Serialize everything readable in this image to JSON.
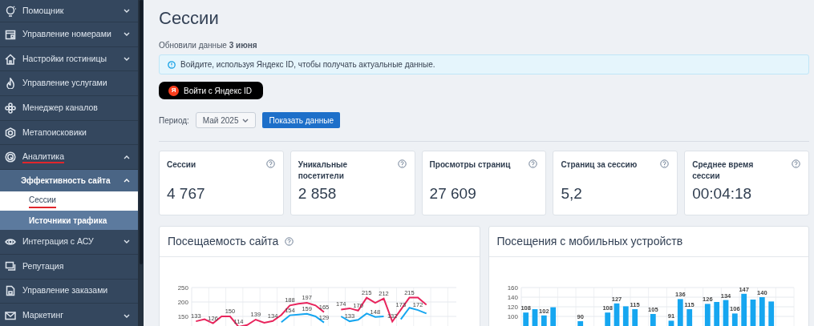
{
  "sidebar": {
    "items": [
      {
        "label": "Помощник",
        "expandable": true,
        "expanded": false,
        "underlined": false
      },
      {
        "label": "Управление номерами",
        "expandable": true,
        "expanded": false,
        "underlined": false
      },
      {
        "label": "Настройки гостиницы",
        "expandable": true,
        "expanded": false,
        "underlined": false
      },
      {
        "label": "Управление услугами",
        "expandable": false,
        "underlined": false
      },
      {
        "label": "Менеджер каналов",
        "expandable": false,
        "underlined": false
      },
      {
        "label": "Метапоисковики",
        "expandable": false,
        "underlined": false
      },
      {
        "label": "Аналитика",
        "expandable": true,
        "expanded": true,
        "underlined": true,
        "children": [
          {
            "label": "Эффективность сайта",
            "expandable": true,
            "expanded": true,
            "children": [
              {
                "label": "Сессии",
                "selected": true,
                "underlined": true
              },
              {
                "label": "Источники трафика",
                "selected": false,
                "underlined": false
              }
            ]
          }
        ]
      },
      {
        "label": "Интеграция с АСУ",
        "expandable": true,
        "expanded": false,
        "underlined": false
      },
      {
        "label": "Репутация",
        "expandable": false,
        "underlined": false
      },
      {
        "label": "Управление заказами",
        "expandable": false,
        "underlined": false
      },
      {
        "label": "Маркетинг",
        "expandable": true,
        "expanded": false,
        "underlined": false
      }
    ]
  },
  "page": {
    "title": "Сессии",
    "updated": "Обновили данные **3 июня**",
    "alert": "Войдите, используя Яндекс ID, чтобы получать актуальные данные.",
    "yandex_button": {
      "logo": "Я",
      "label": "Войти с Яндекс ID"
    },
    "period": {
      "label": "Период:",
      "value": "Май 2025"
    },
    "show_button": "Показать данные"
  },
  "metrics": [
    {
      "label": "Сессии",
      "value": "4 767"
    },
    {
      "label": "Уникальные посетители",
      "value": "2 858"
    },
    {
      "label": "Просмотры страниц",
      "value": "27 609"
    },
    {
      "label": "Страниц за сессию",
      "value": "5,2"
    },
    {
      "label": "Среднее время сессии",
      "value": "00:04:18"
    }
  ],
  "charts": [
    {
      "title": "Посещаемость сайта",
      "help": true,
      "chart_data": {
        "type": "line",
        "grid": true,
        "ylim": [
          0,
          250
        ],
        "yticks": [
          150,
          200,
          250
        ],
        "series": [
          {
            "color": "#e8245c",
            "values": [
              133,
              140,
              126,
              150,
              150,
              114,
              120,
              139,
              128,
              134,
              155,
              188,
              194,
              197,
              188,
              165,
              null,
              174,
              178,
              170,
              215,
              197,
              212,
              132,
              173,
              215,
              215,
              190,
              null,
              null,
              null
            ]
          },
          {
            "color": "#16a6f0",
            "values": [
              null,
              null,
              null,
              null,
              null,
              null,
              null,
              null,
              null,
              null,
              130,
              154,
              156,
              159,
              150,
              129,
              null,
              150,
              133,
              138,
              160,
              148,
              150,
              null,
              140,
              180,
              172,
              160,
              null,
              null,
              null
            ]
          }
        ],
        "value_labels": [
          [
            "133",
            null,
            "126",
            null,
            "150",
            "114",
            null,
            "139",
            null,
            "134",
            null,
            "188",
            null,
            "197",
            null,
            "165",
            null,
            "174",
            null,
            "170",
            "215",
            null,
            "212",
            "132",
            "173",
            "215",
            null,
            null,
            null,
            null,
            null
          ],
          [
            null,
            null,
            null,
            null,
            null,
            null,
            null,
            null,
            null,
            null,
            null,
            "154",
            null,
            "159",
            null,
            "129",
            null,
            null,
            "133",
            null,
            null,
            "148",
            null,
            null,
            null,
            null,
            "172",
            null,
            null,
            null,
            null
          ]
        ]
      }
    },
    {
      "title": "Посещения с мобильных устройств",
      "help": false,
      "chart_data": {
        "type": "bar",
        "grid": true,
        "ylim": [
          0,
          160
        ],
        "yticks": [
          100,
          120,
          140,
          160
        ],
        "series": [
          {
            "color": "#16a6f0",
            "values": [
              108,
              115,
              102,
              119,
              null,
              null,
              90,
              null,
              null,
              108,
              127,
              121,
              115,
              null,
              105,
              null,
              91,
              136,
              115,
              null,
              126,
              130,
              134,
              106,
              147,
              135,
              140,
              131,
              null,
              null
            ]
          }
        ],
        "value_labels": [
          [
            "108",
            null,
            "102",
            null,
            null,
            null,
            "90",
            null,
            null,
            "108",
            "127",
            null,
            "115",
            null,
            "105",
            null,
            "91",
            "136",
            "115",
            null,
            "126",
            null,
            "134",
            "106",
            "147",
            null,
            "140",
            null,
            null,
            null
          ]
        ]
      }
    }
  ]
}
